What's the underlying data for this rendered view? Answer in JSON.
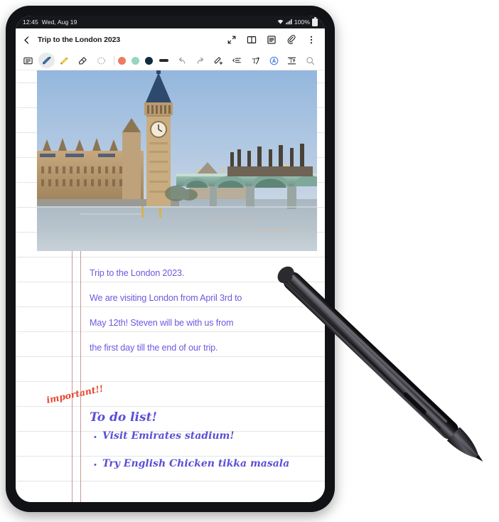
{
  "statusbar": {
    "time": "12:45",
    "date": "Wed, Aug 19",
    "battery_percent": "100%",
    "icons": [
      "wifi-icon",
      "signal-icon",
      "battery-icon"
    ]
  },
  "titlebar": {
    "back_label": "back-chevron",
    "title": "Trip to the London 2023",
    "actions": [
      {
        "name": "expand-icon",
        "label": "Expand"
      },
      {
        "name": "book-view-icon",
        "label": "Book view"
      },
      {
        "name": "note-list-icon",
        "label": "Note list"
      },
      {
        "name": "attach-icon",
        "label": "Attach"
      },
      {
        "name": "more-options-icon",
        "label": "More options"
      }
    ]
  },
  "toolbar": {
    "tools": [
      {
        "name": "text-tool",
        "label": "Text",
        "selected": false
      },
      {
        "name": "pen-tool",
        "label": "Pen",
        "selected": true
      },
      {
        "name": "highlighter-tool",
        "label": "Highlighter",
        "selected": false
      },
      {
        "name": "eraser-tool",
        "label": "Eraser",
        "selected": false
      },
      {
        "name": "lasso-select-tool",
        "label": "Selection",
        "selected": false
      }
    ],
    "colors": [
      {
        "name": "color-coral",
        "hex": "#ef7a62",
        "selected": false
      },
      {
        "name": "color-mint",
        "hex": "#95d5c2",
        "selected": false
      },
      {
        "name": "color-navy",
        "hex": "#0f2d3d",
        "selected": true
      }
    ],
    "stroke_name": "stroke-thickness",
    "stroke_color": "#2a2b2f",
    "actions": [
      {
        "name": "undo-button",
        "label": "Undo"
      },
      {
        "name": "redo-button",
        "label": "Redo"
      },
      {
        "name": "pen-settings-icon",
        "label": "Pen settings"
      },
      {
        "name": "paragraph-align-icon",
        "label": "Align"
      },
      {
        "name": "text-convert-icon",
        "label": "Convert to text"
      },
      {
        "name": "ai-assist-icon",
        "label": "AI assist"
      },
      {
        "name": "straighten-text-icon",
        "label": "Straighten"
      },
      {
        "name": "search-icon",
        "label": "Search"
      }
    ]
  },
  "note": {
    "photo_alt": "Big Ben and Westminster Bridge over the River Thames at dusk",
    "paragraph": [
      "Trip to the London 2023.",
      "We are visiting London from April 3rd to",
      "May 12th! Steven will be with us from",
      "the first day till the end of our trip."
    ],
    "annotation": "important!!",
    "heading": "To do list!",
    "todo": [
      "Visit Emirates stadium!",
      "Try English Chicken tikka masala"
    ],
    "text_color": "#6a5ae0",
    "annotation_color": "#e8452c",
    "rule_color": "#e4e5e7",
    "margin_color": "#c99a9a"
  },
  "device": {
    "stylus_name": "s-pen-stylus"
  }
}
